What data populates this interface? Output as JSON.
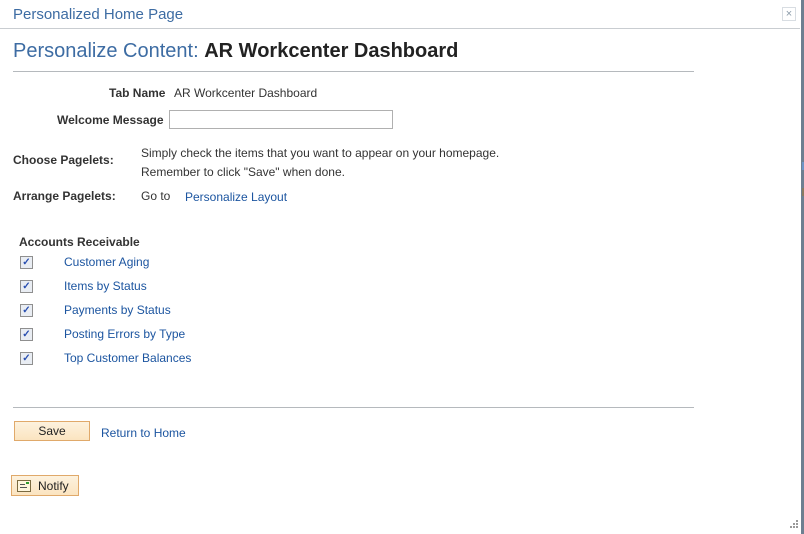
{
  "window": {
    "title": "Personalized Home Page",
    "close_icon": "×"
  },
  "heading": {
    "prefix": "Personalize Content:",
    "name": "AR Workcenter Dashboard"
  },
  "form": {
    "tab_name_label": "Tab Name",
    "tab_name_value": "AR Workcenter Dashboard",
    "welcome_label": "Welcome Message",
    "welcome_value": "",
    "choose_label": "Choose Pagelets:",
    "choose_line1": "Simply check the items that you want to appear on your homepage.",
    "choose_line2": "Remember to click \"Save\" when done.",
    "arrange_label": "Arrange Pagelets:",
    "arrange_goto": "Go to",
    "arrange_link": "Personalize Layout"
  },
  "pagelets": {
    "group_title": "Accounts Receivable",
    "items": [
      {
        "label": "Customer Aging",
        "checked": true
      },
      {
        "label": "Items by Status",
        "checked": true
      },
      {
        "label": "Payments by Status",
        "checked": true
      },
      {
        "label": "Posting Errors by Type",
        "checked": true
      },
      {
        "label": "Top Customer Balances",
        "checked": true
      }
    ]
  },
  "actions": {
    "save_label": "Save",
    "return_label": "Return to Home",
    "notify_label": "Notify",
    "checkmark": "✓"
  }
}
